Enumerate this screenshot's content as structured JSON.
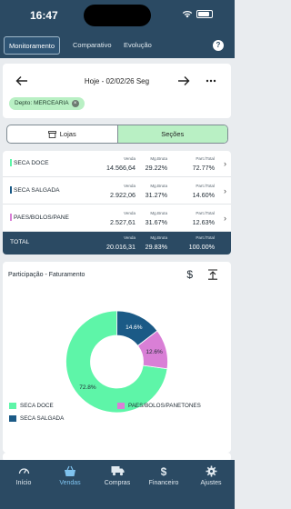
{
  "status_bar": {
    "time": "16:47"
  },
  "top_nav": {
    "tabs": [
      {
        "label": "Monitoramento",
        "active": true
      },
      {
        "label": "Comparativo",
        "active": false
      },
      {
        "label": "Evolução",
        "active": false
      }
    ],
    "help_label": "?"
  },
  "date_card": {
    "date_label": "Hoje - 02/02/26 Seg",
    "filter_chip": "Depto: MERCEARIA"
  },
  "segment": {
    "stores_label": "Lojas",
    "sections_label": "Seções",
    "active": "Seções"
  },
  "table": {
    "headers": {
      "sales": "Venda",
      "margin": "Mg.Bruta",
      "share": "Part./Total"
    },
    "rows": [
      {
        "name": "SECA DOCE",
        "color": "#5ef5a8",
        "sales": "14.566,64",
        "margin": "29.22%",
        "share": "72.77%"
      },
      {
        "name": "SECA SALGADA",
        "color": "#1b5a86",
        "sales": "2.922,06",
        "margin": "31.27%",
        "share": "14.60%"
      },
      {
        "name": "PAES/BOLOS/PANE",
        "color": "#d97fd6",
        "sales": "2.527,61",
        "margin": "31.67%",
        "share": "12.63%"
      }
    ],
    "total": {
      "label": "TOTAL",
      "sales": "20.016,31",
      "margin": "29.83%",
      "share": "100.00%"
    }
  },
  "chart_card": {
    "title": "Participação - Faturamento",
    "dollar_label": "$"
  },
  "chart_data": {
    "type": "pie",
    "donut": true,
    "series": [
      {
        "name": "SECA DOCE",
        "value": 72.8,
        "label": "72.8%",
        "color": "#5ef5a8"
      },
      {
        "name": "SECA SALGADA",
        "value": 14.6,
        "label": "14.6%",
        "color": "#1b5a86"
      },
      {
        "name": "PAES/BOLOS/PANETONES",
        "value": 12.6,
        "label": "12.6%",
        "color": "#d97fd6"
      }
    ],
    "legend": [
      "SECA DOCE",
      "PAES/BOLOS/PANETONES",
      "SECA SALGADA"
    ]
  },
  "bottom_nav": {
    "items": [
      {
        "label": "Início",
        "icon": "gauge-icon",
        "active": false
      },
      {
        "label": "Vendas",
        "icon": "basket-icon",
        "active": true
      },
      {
        "label": "Compras",
        "icon": "truck-icon",
        "active": false
      },
      {
        "label": "Financeiro",
        "icon": "dollar-icon",
        "active": false
      },
      {
        "label": "Ajustes",
        "icon": "gear-icon",
        "active": false
      }
    ]
  }
}
